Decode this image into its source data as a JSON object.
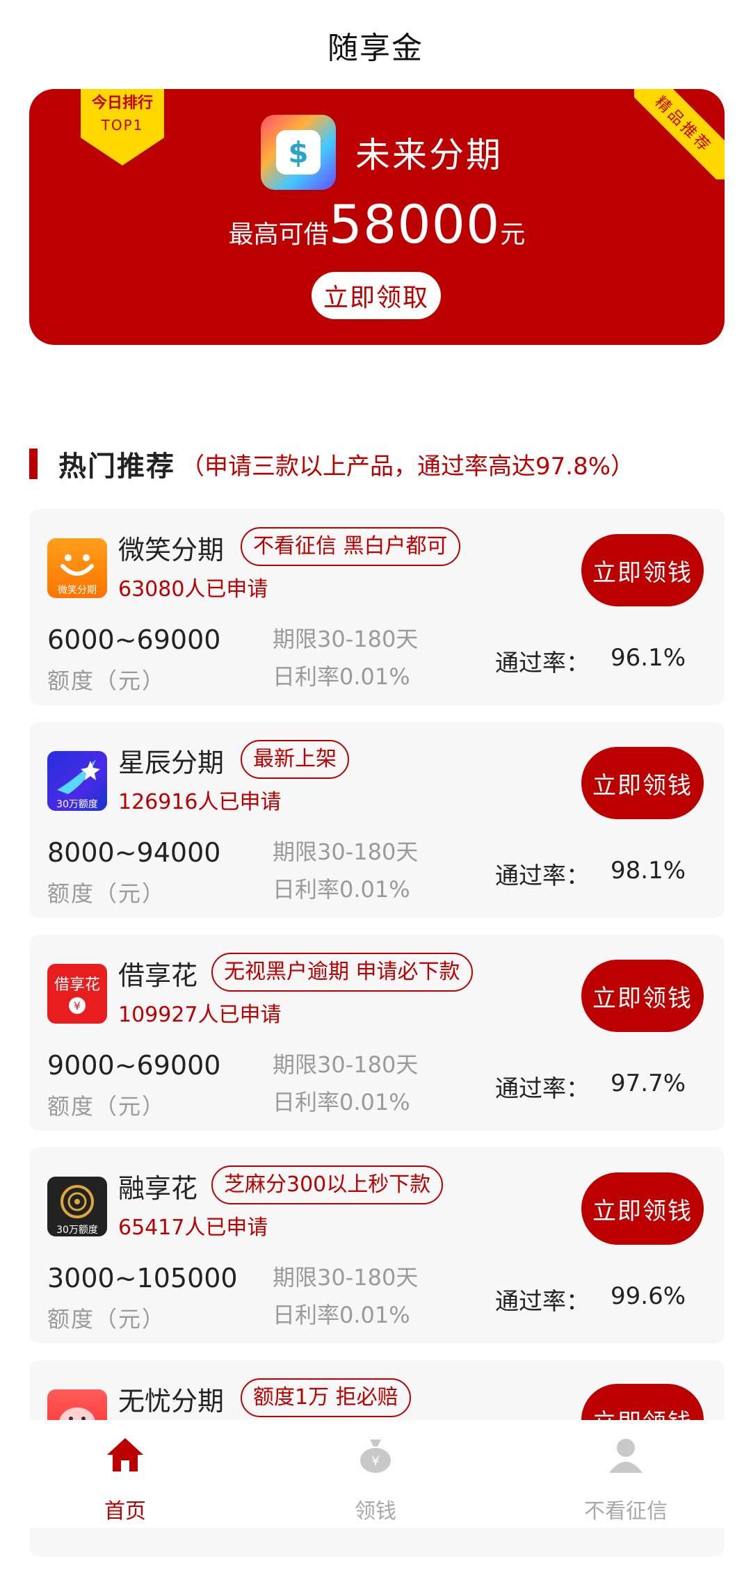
{
  "header": {
    "title": "随享金"
  },
  "banner": {
    "rank_line1": "今日排行",
    "rank_line2": "TOP1",
    "corner_tag": "精品推荐",
    "app_name": "未来分期",
    "amount_prefix": "最高可借",
    "amount": "58000",
    "amount_unit": "元",
    "button": "立即领取",
    "colors": {
      "background": "#bc0000",
      "ribbon": "#ffd800"
    }
  },
  "section": {
    "title": "热门推荐",
    "subtitle": "（申请三款以上产品，通过率高达97.8%）"
  },
  "products": [
    {
      "name": "微笑分期",
      "tag": "不看征信 黑白户都可",
      "applied": "63080人已申请",
      "range": "6000~69000",
      "range_label": "额度（元）",
      "term": "期限30-180天",
      "rate": "日利率0.01%",
      "pass_label": "通过率：",
      "pass_value": "96.1%",
      "button": "立即领钱",
      "logo_text": "微笑分期",
      "logo_icon": "smile-face-icon"
    },
    {
      "name": "星辰分期",
      "tag": "最新上架",
      "applied": "126916人已申请",
      "range": "8000~94000",
      "range_label": "额度（元）",
      "term": "期限30-180天",
      "rate": "日利率0.01%",
      "pass_label": "通过率：",
      "pass_value": "98.1%",
      "button": "立即领钱",
      "logo_text": "30万额度",
      "logo_icon": "shooting-star-icon"
    },
    {
      "name": "借享花",
      "tag": "无视黑户逾期 申请必下款",
      "applied": "109927人已申请",
      "range": "9000~69000",
      "range_label": "额度（元）",
      "term": "期限30-180天",
      "rate": "日利率0.01%",
      "pass_label": "通过率：",
      "pass_value": "97.7%",
      "button": "立即领钱",
      "logo_text": "借享花",
      "logo_icon": "yen-coin-icon"
    },
    {
      "name": "融享花",
      "tag": "芝麻分300以上秒下款",
      "applied": "65417人已申请",
      "range": "3000~105000",
      "range_label": "额度（元）",
      "term": "期限30-180天",
      "rate": "日利率0.01%",
      "pass_label": "通过率：",
      "pass_value": "99.6%",
      "button": "立即领钱",
      "logo_text": "30万额度",
      "logo_icon": "gold-emblem-icon"
    },
    {
      "name": "无忧分期",
      "tag": "额度1万 拒必赔",
      "button": "立即领钱",
      "logo_icon": "pig-icon"
    }
  ],
  "tabbar": {
    "items": [
      {
        "label": "首页",
        "icon": "home-icon",
        "active": true
      },
      {
        "label": "领钱",
        "icon": "money-bag-icon",
        "active": false
      },
      {
        "label": "不看征信",
        "icon": "user-icon",
        "active": false
      }
    ],
    "colors": {
      "active": "#bc0000",
      "inactive": "#a8a8a8"
    }
  }
}
